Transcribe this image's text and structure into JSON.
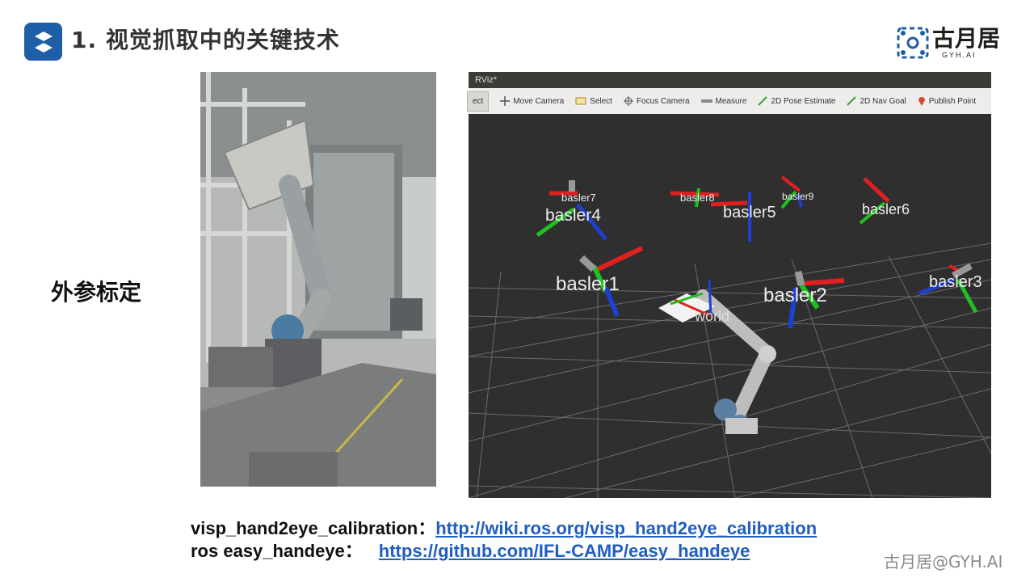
{
  "slide": {
    "title": "1. 视觉抓取中的关键技术",
    "section_label": "外参标定"
  },
  "brand": {
    "name": "古月居",
    "sub": "GYH.AI",
    "icon": "gyh-logo-icon",
    "accent": "#1f5fa8"
  },
  "rviz": {
    "window_title": "RViz*",
    "toolbar": [
      {
        "label": "ect",
        "icon": "interact-icon"
      },
      {
        "label": "Move Camera",
        "icon": "move-camera-icon"
      },
      {
        "label": "Select",
        "icon": "select-icon"
      },
      {
        "label": "Focus Camera",
        "icon": "focus-camera-icon"
      },
      {
        "label": "Measure",
        "icon": "measure-icon"
      },
      {
        "label": "2D Pose Estimate",
        "icon": "pose-estimate-icon"
      },
      {
        "label": "2D Nav Goal",
        "icon": "nav-goal-icon"
      },
      {
        "label": "Publish Point",
        "icon": "publish-point-icon"
      }
    ],
    "frames": [
      "basler7",
      "basler4",
      "basler8",
      "basler5",
      "basler9",
      "basler6",
      "basler1",
      "basler2",
      "basler3",
      "world"
    ]
  },
  "links": {
    "row1_label": "visp_hand2eye_calibration：",
    "row1_url": "http://wiki.ros.org/visp_hand2eye_calibration",
    "row2_label": "ros easy_handeye：",
    "row2_url": "https://github.com/IFL-CAMP/easy_handeye"
  },
  "watermark": "古月居@GYH.AI"
}
